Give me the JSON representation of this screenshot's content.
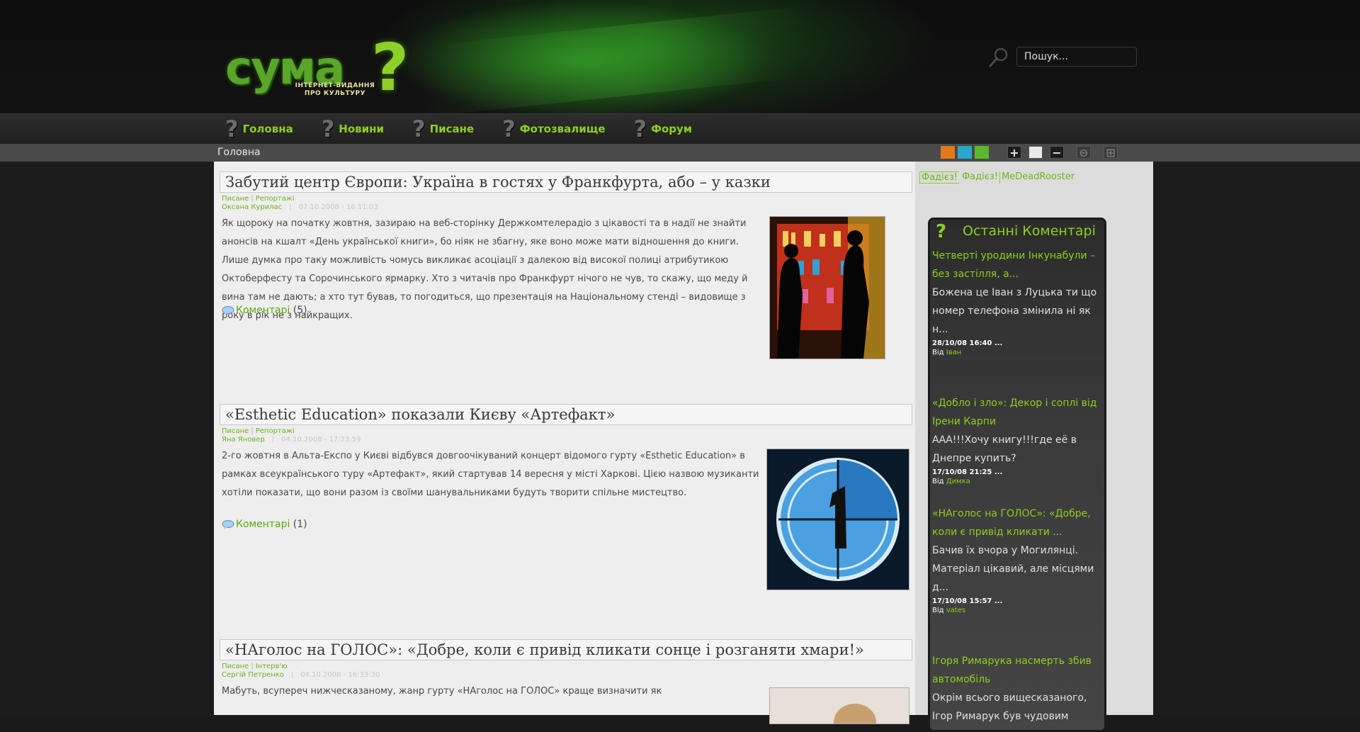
{
  "logo": {
    "word": "сума",
    "sub_line1": "ІНТЕРНЕТ-ВИДАННЯ",
    "sub_line2": "ПРО КУЛЬТУРУ"
  },
  "search": {
    "placeholder": "Пошук..."
  },
  "nav": {
    "items": [
      {
        "label": "Головна"
      },
      {
        "label": "Новини"
      },
      {
        "label": "Писане"
      },
      {
        "label": "Фотозвалище"
      },
      {
        "label": "Форум"
      }
    ]
  },
  "breadcrumb": {
    "current": "Головна"
  },
  "toolbar": {
    "colors": [
      "#e07a1a",
      "#2aa6c8",
      "#5cb82a"
    ],
    "zoom_in": "+",
    "reset": "",
    "zoom_out": "−"
  },
  "articles": [
    {
      "title": "Забутий центр Європи: Україна в гостях у Франкфурта, або – у казки",
      "category": "Писане",
      "subcategory": "Репортажі",
      "author": "Оксана Курилас",
      "date": "07.10.2008 - 16:11:03",
      "body": "Як щороку на початку жовтня, зазираю на веб-сторінку Держкомтелерадіо з цікавості та в надії не знайти анонсів на кшалт «День української книги», бо ніяк не збагну, яке воно може мати відношення до книги. Лише думка про таку можливість чомусь викликає асоціації з далекою від високої полиці атрибутикою Октоберфесту та Сорочинського ярмарку. Хто з читачів про Франкфурт нічого не чув, то скажу, що меду й вина там не дають; а хто тут бував, то погодиться, що презентація на Національному стенді – видовище з року в рік не з найкращих.",
      "comments_label": "Коментарі",
      "comments_count": "(5)"
    },
    {
      "title": "«Esthetic Education» показали Києву «Артефакт»",
      "category": "Писане",
      "subcategory": "Репортажі",
      "author": "Яна Яновер",
      "date": "04.10.2008 - 17:23:59",
      "body": "2-го жовтня в Альта-Експо у Києві відбувся довгоочікуваний концерт відомого гурту «Esthetic Education» в рамках всеукраїнського туру «Артефакт», який стартував 14 вересня у місті Харкові. Цією назвою музиканти хотіли показати, що вони разом із своїми шанувальниками будуть творити спільне мистецтво.",
      "comments_label": "Коментарі",
      "comments_count": "(1)"
    },
    {
      "title": "«НАголос на ГОЛОС»: «Добре, коли є привід кликати сонце і розганяти хмари!»",
      "category": "Писане",
      "subcategory": "Інтерв'ю",
      "author": "Сергій Петренко",
      "date": "04.10.2008 - 16:33:30",
      "body": "Мабуть, всупереч нижческазаному, жанр гурту «НАголос на ГОЛОС» краще визначити як"
    }
  ],
  "sidebar": {
    "tags": [
      "Фадієз!",
      "Фадієз!",
      "MeDeadRooster"
    ],
    "comments_title": "Останні Коментарі",
    "comments": [
      {
        "title": "Четверті уродини Інкунабули – без застілля, а...",
        "text": "Божена це Іван з Луцька ти що номер телефона змінила ні як н...",
        "date": "28/10/08 16:40 ...",
        "by_label": "Від",
        "user": "Іван"
      },
      {
        "title": "«Добло і зло»: Декор і соплі від Ірени Карпи",
        "text": "ААА!!!Хочу книгу!!!где её в Днепре купить?",
        "date": "17/10/08 21:25 ...",
        "by_label": "Від",
        "user": "Димка"
      },
      {
        "title": "«НАголос на ГОЛОС»: «Добре, коли є привід кликати ...",
        "text": "Бачив їх вчора у Могилянці. Матеріал цікавий, але місцями д...",
        "date": "17/10/08 15:57 ...",
        "by_label": "Від",
        "user": "vates"
      },
      {
        "title": "Ігоря Римарука насмерть збив автомобіль",
        "text": "Окрім всього вищесказаного, Ігор Римарук був чудовим"
      }
    ]
  }
}
